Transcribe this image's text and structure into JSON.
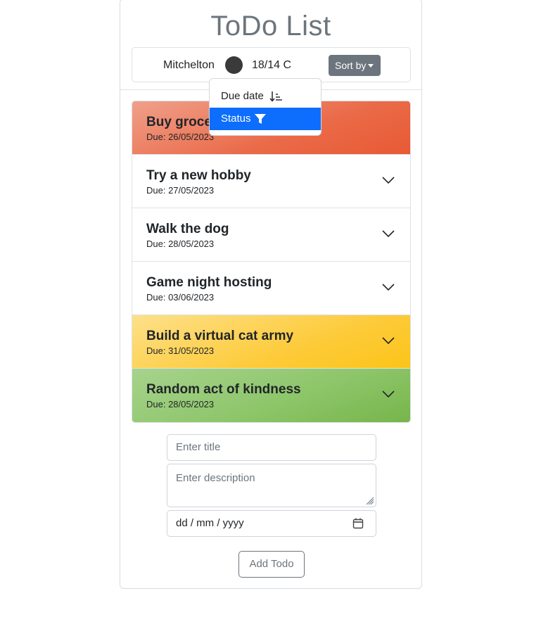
{
  "header": {
    "title": "ToDo List"
  },
  "info": {
    "location": "Mitchelton",
    "temperature": "18/14 C",
    "sort_label": "Sort by"
  },
  "sort_menu": {
    "items": [
      {
        "label": "Due date",
        "icon": "sort-numeric-down-icon",
        "active": false
      },
      {
        "label": "Status",
        "icon": "filter-icon",
        "active": true
      }
    ]
  },
  "todos": [
    {
      "title": "Buy groceries",
      "due": "Due: 26/05/2023",
      "status_color": "#e85a34"
    },
    {
      "title": "Try a new hobby",
      "due": "Due: 27/05/2023",
      "status_color": "#ffffff"
    },
    {
      "title": "Walk the dog",
      "due": "Due: 28/05/2023",
      "status_color": "#ffffff"
    },
    {
      "title": "Game night hosting",
      "due": "Due: 03/06/2023",
      "status_color": "#ffffff"
    },
    {
      "title": "Build a virtual cat army",
      "due": "Due: 31/05/2023",
      "status_color": "#fcc419"
    },
    {
      "title": "Random act of kindness",
      "due": "Due: 28/05/2023",
      "status_color": "#77b54b"
    }
  ],
  "form": {
    "title_placeholder": "Enter title",
    "description_placeholder": "Enter description",
    "date_placeholder": "dd / mm / yyyy",
    "add_label": "Add Todo"
  },
  "colors": {
    "accent": "#0d6efd",
    "secondary": "#6c757d",
    "overdue": "#e85a34",
    "pending": "#fcc419",
    "done": "#77b54b"
  }
}
